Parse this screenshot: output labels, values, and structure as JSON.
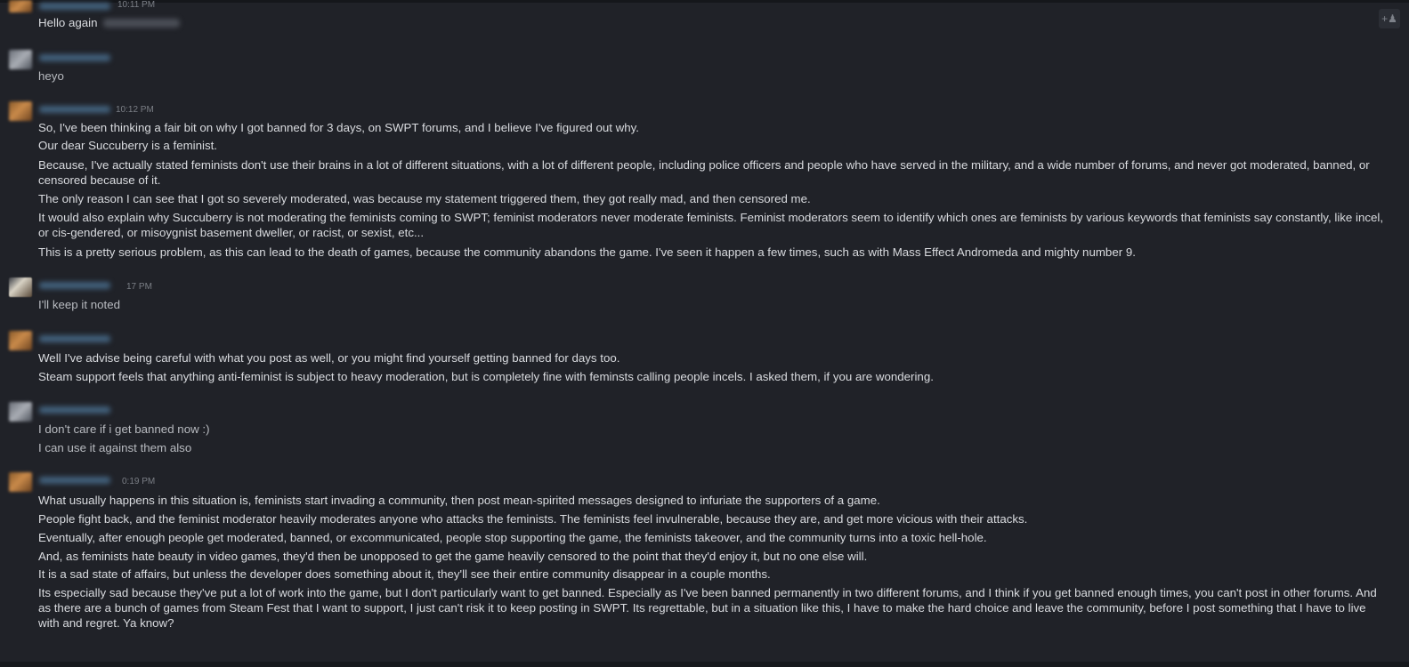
{
  "messages": {
    "g1": {
      "time": "10:11 PM",
      "lines": [
        "Hello again"
      ]
    },
    "g2": {
      "time": "",
      "lines": [
        "heyo"
      ]
    },
    "g3": {
      "time": "10:12 PM",
      "lines": [
        "So, I've been thinking a fair bit on why I got banned for 3 days, on SWPT forums, and I believe I've figured out why.",
        "Our dear Succuberry is a feminist.",
        "Because, I've actually stated feminists don't use their brains in a lot of different situations, with a lot of different people, including police officers and people who have served in the military, and a wide number of forums, and never got moderated, banned, or censored because of it.",
        "The only reason I can see that I got so severely moderated, was because my statement triggered them, they got really mad, and then censored me.",
        "It would also explain why Succuberry is not moderating the feminists coming to SWPT; feminist moderators never moderate feminists. Feminist moderators seem to identify which ones are feminists by various keywords that feminists say constantly, like incel, or cis-gendered, or misoygnist basement dweller, or racist, or sexist, etc...",
        "This is a pretty serious problem, as this can lead to the death of games, because the community abandons the game. I've seen it happen a few times, such as with Mass Effect Andromeda and mighty number 9."
      ]
    },
    "g4": {
      "time": "17 PM",
      "lines": [
        "I'll keep it noted"
      ]
    },
    "g5": {
      "time": "",
      "lines": [
        "Well I've advise being careful with what you post as well, or you might find yourself getting banned for days too.",
        "Steam support feels that anything anti-feminist is subject to heavy moderation, but is completely fine with feminsts calling people incels. I asked them, if you are wondering."
      ]
    },
    "g6": {
      "time": "",
      "lines": [
        "I don't care if i get banned now :)",
        "I can use it against them also"
      ]
    },
    "g7": {
      "time": "0:19 PM",
      "lines": [
        "What usually happens in this situation is, feminists start invading a community, then post mean-spirited messages designed to infuriate the supporters of a game.",
        "People fight back, and the feminist moderator heavily moderates anyone who attacks the feminists. The feminists feel invulnerable, because they are, and get more vicious with their attacks.",
        "Eventually, after enough people get moderated, banned, or excommunicated, people stop supporting the game, the feminists takeover, and the community turns into a toxic hell-hole.",
        "And, as feminists hate beauty in video games, they'd then be unopposed to get the game heavily censored to the point that they'd enjoy it, but no one else will.",
        "It is a sad state of affairs, but unless the developer does something about it, they'll see their entire community disappear in a couple months.",
        "Its especially sad because they've put a lot of work into the game, but I don't particularly want to get banned. Especially as I've been banned permanently in two different forums, and I think if you get banned enough times, you can't post in other forums. And as there are a bunch of games from Steam Fest that I want to support, I just can't risk it to keep posting in SWPT. Its regrettable, but in a situation like this, I have to make the hard choice and leave the community, before I post something that I have to live with and regret. Ya know?"
      ]
    }
  },
  "icons": {
    "add_friend": "add-friend-icon"
  },
  "colors": {
    "background": "#202228",
    "text": "#d9dbdf",
    "timestamp": "#7b7f86",
    "name_blurred": "#5f86a8"
  }
}
